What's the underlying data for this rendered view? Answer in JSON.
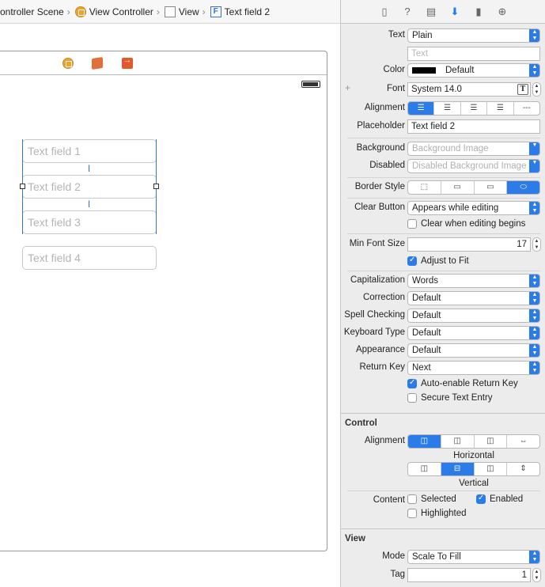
{
  "breadcrumb": {
    "items": [
      "ontroller Scene",
      "View Controller",
      "View",
      "Text field 2"
    ]
  },
  "canvas": {
    "text_fields": [
      "Text field 1",
      "Text field 2",
      "Text field 3",
      "Text field 4"
    ]
  },
  "inspector": {
    "tab_icons": [
      "file-icon",
      "help-icon",
      "identity-icon",
      "attributes-icon",
      "size-icon",
      "connections-icon"
    ],
    "text_field": {
      "text_label": "Text",
      "text_value": "Plain",
      "text_placeholder": "Text",
      "color_label": "Color",
      "color_value": "Default",
      "font_label": "Font",
      "font_value": "System 14.0",
      "alignment_label": "Alignment",
      "placeholder_label": "Placeholder",
      "placeholder_value": "Text field 2",
      "background_label": "Background",
      "background_placeholder": "Background Image",
      "disabled_label": "Disabled",
      "disabled_placeholder": "Disabled Background Image",
      "border_style_label": "Border Style",
      "clear_button_label": "Clear Button",
      "clear_button_value": "Appears while editing",
      "clear_when_editing_label": "Clear when editing begins",
      "min_font_size_label": "Min Font Size",
      "min_font_size_value": "17",
      "adjust_to_fit_label": "Adjust to Fit",
      "capitalization_label": "Capitalization",
      "capitalization_value": "Words",
      "correction_label": "Correction",
      "correction_value": "Default",
      "spell_checking_label": "Spell Checking",
      "spell_checking_value": "Default",
      "keyboard_type_label": "Keyboard Type",
      "keyboard_type_value": "Default",
      "appearance_label": "Appearance",
      "appearance_value": "Default",
      "return_key_label": "Return Key",
      "return_key_value": "Next",
      "auto_enable_label": "Auto-enable Return Key",
      "secure_entry_label": "Secure Text Entry"
    },
    "control": {
      "section_title": "Control",
      "alignment_label": "Alignment",
      "horizontal_caption": "Horizontal",
      "vertical_caption": "Vertical",
      "content_label": "Content",
      "selected_label": "Selected",
      "enabled_label": "Enabled",
      "highlighted_label": "Highlighted"
    },
    "view": {
      "section_title": "View",
      "mode_label": "Mode",
      "mode_value": "Scale To Fill",
      "tag_label": "Tag",
      "tag_value": "1"
    },
    "state": {
      "clear_when_editing": false,
      "adjust_to_fit": true,
      "auto_enable_return_key": true,
      "secure_text_entry": false,
      "selected": false,
      "enabled": true,
      "highlighted": false
    },
    "colors": {
      "accent": "#2b7ce9",
      "text_color_swatch": "#000000"
    }
  }
}
